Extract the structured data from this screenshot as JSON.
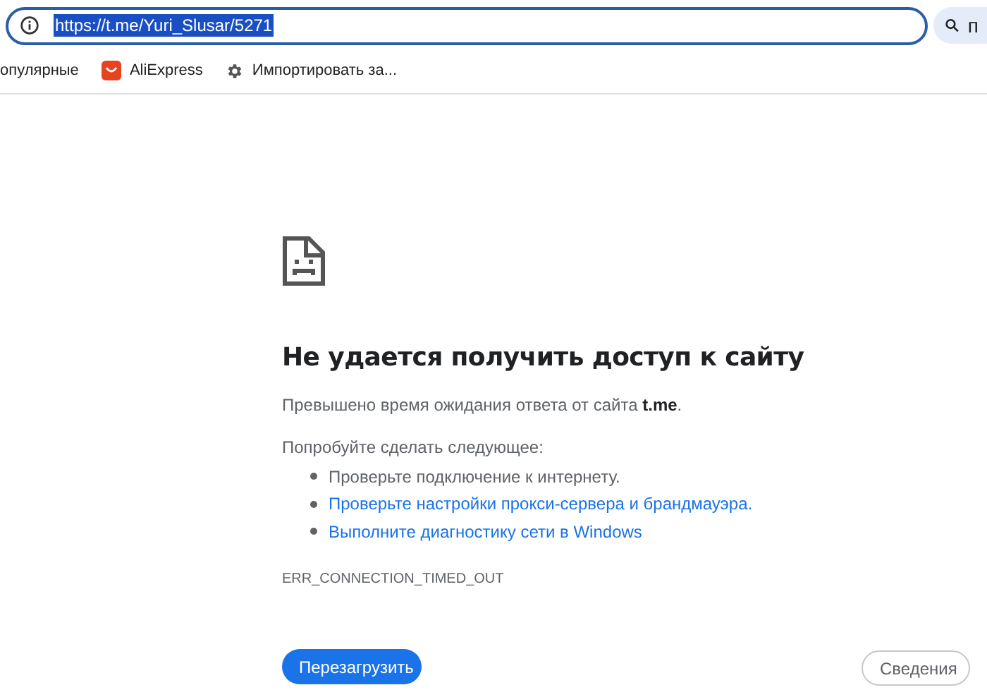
{
  "address_bar": {
    "url": "https://t.me/Yuri_Slusar/5271",
    "selected": true,
    "search_chip": "п"
  },
  "bookmarks": [
    {
      "kind": "plain",
      "label": "опулярные"
    },
    {
      "kind": "aliexpress",
      "label": "AliExpress"
    },
    {
      "kind": "gear",
      "label": "Импортировать за..."
    }
  ],
  "error": {
    "title": "Не удается получить доступ к сайту",
    "message": "Превышено время ожидания ответа от сайта **t.me**.",
    "suggestions_heading": "Попробуйте сделать следующее:",
    "suggestions": [
      {
        "text": "Проверьте подключение к интернету.",
        "link": false
      },
      {
        "text": "Проверьте настройки прокси-сервера и брандмауэра.",
        "link": true
      },
      {
        "text": "Выполните диагностику сети в Windows",
        "link": true
      }
    ],
    "code": "ERR_CONNECTION_TIMED_OUT"
  },
  "buttons": {
    "reload": "Перезагрузить",
    "details": "Сведения"
  }
}
